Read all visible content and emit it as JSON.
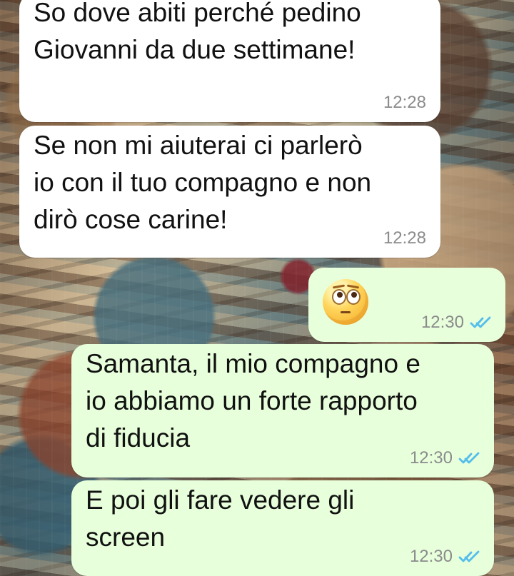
{
  "messages": [
    {
      "text": "So dove abiti perché pedino\nGiovanni da due settimane!",
      "time": "12:28"
    },
    {
      "text": "Se non mi aiuterai ci parlerò\nio con il tuo compagno e non\ndirò cose carine!",
      "time": "12:28"
    },
    {
      "emoji": "face-with-rolling-eyes",
      "time": "12:30",
      "status_icon": "double-check-read-icon",
      "status_color": "#53bdeb"
    },
    {
      "text": "Samanta, il mio compagno e\nio abbiamo un forte rapporto\ndi fiducia",
      "time": "12:30",
      "status_icon": "double-check-read-icon",
      "status_color": "#53bdeb"
    },
    {
      "text": "E poi gli fare vedere gli\nscreen",
      "time": "12:30",
      "status_icon": "double-check-read-icon",
      "status_color": "#53bdeb"
    }
  ],
  "colors": {
    "incoming_bubble": "#ffffff",
    "outgoing_bubble": "#e7ffdb",
    "timestamp": "#8b8b8b"
  }
}
